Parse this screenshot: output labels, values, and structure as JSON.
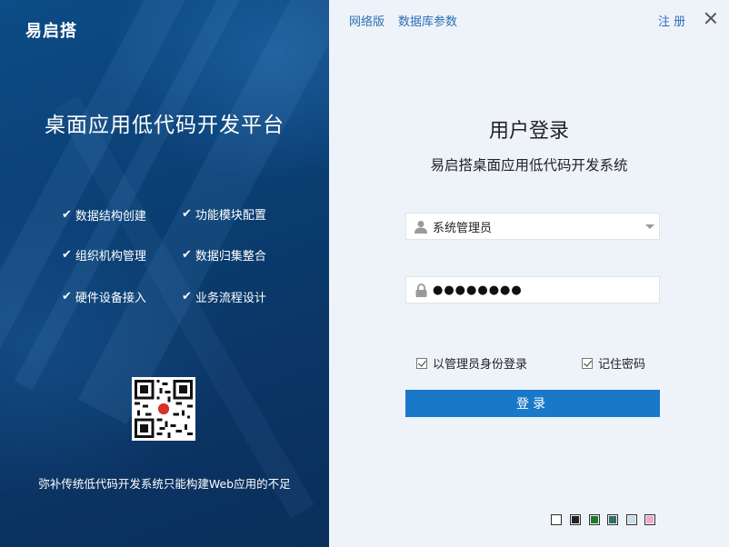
{
  "left": {
    "logo": "易启搭",
    "platform_title": "桌面应用低代码开发平台",
    "features": [
      "数据结构创建",
      "功能模块配置",
      "组织机构管理",
      "数据归集整合",
      "硬件设备接入",
      "业务流程设计"
    ],
    "slogan": "弥补传统低代码开发系统只能构建Web应用的不足"
  },
  "header": {
    "link_web": "网络版",
    "link_db": "数据库参数",
    "link_register": "注 册"
  },
  "login": {
    "title": "用户登录",
    "subtitle": "易启搭桌面应用低代码开发系统",
    "username": "系统管理员",
    "password_mask": "●●●●●●●●",
    "check_admin_label": "以管理员身份登录",
    "check_admin_checked": true,
    "check_remember_label": "记住密码",
    "check_remember_checked": true,
    "submit_label": "登录"
  },
  "theme_swatches": [
    "#ffffff",
    "#222222",
    "#1e7a2e",
    "#2f6f6a",
    "#c9dbe8",
    "#f2a9c9"
  ]
}
